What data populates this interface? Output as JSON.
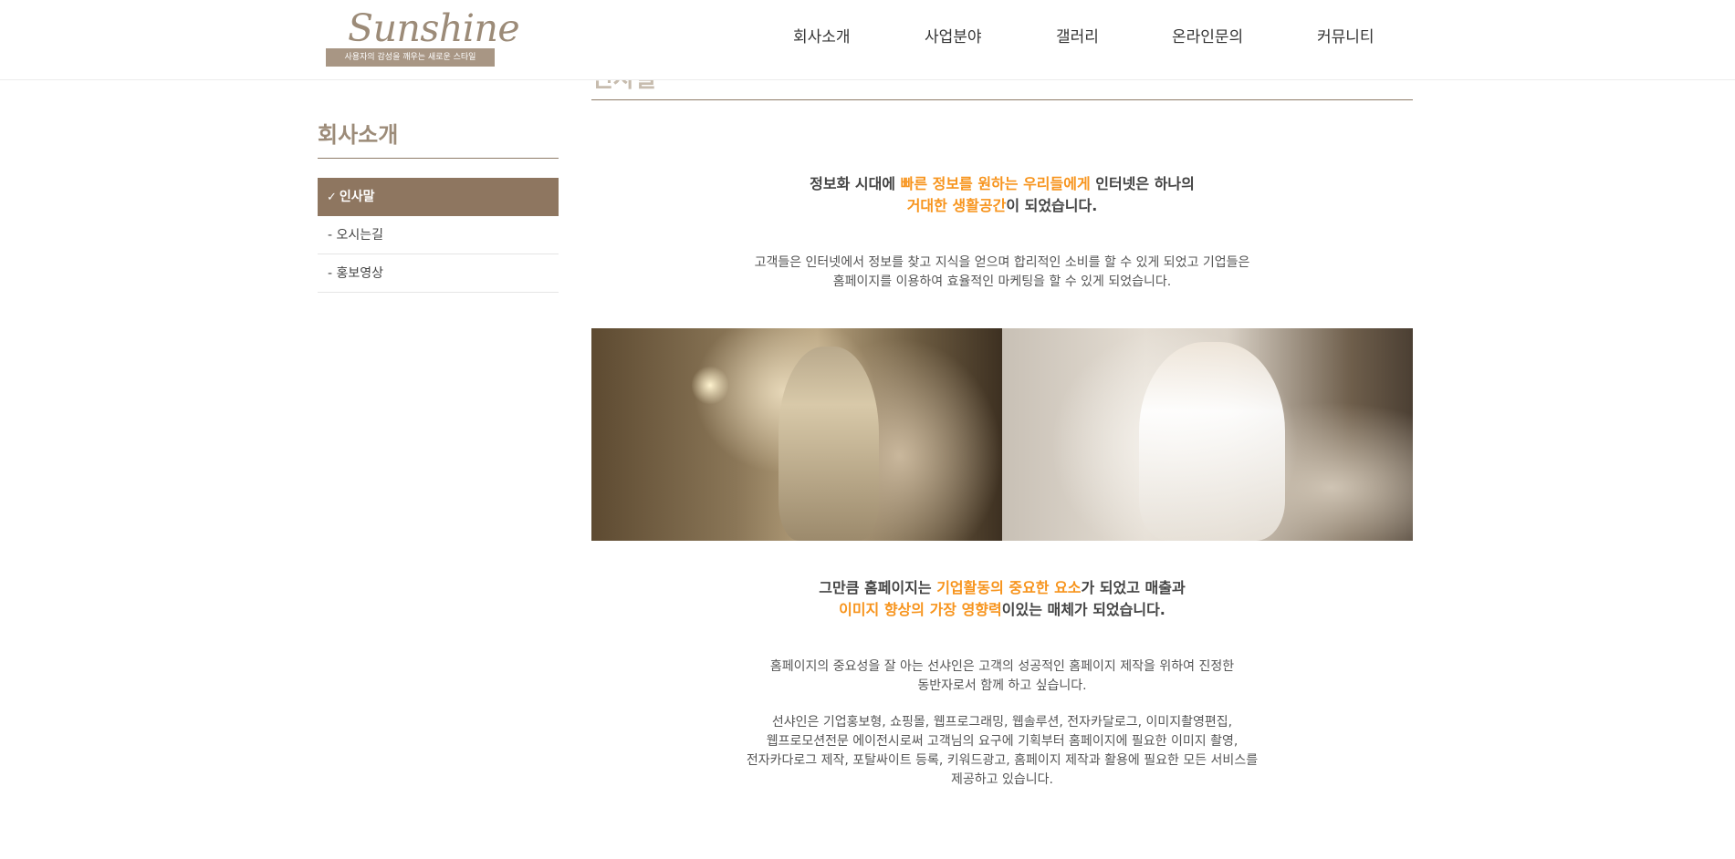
{
  "logo": {
    "word": "Sunshine",
    "tagline": "사용자의 감성을 깨우는 새로운 스타일"
  },
  "nav": [
    {
      "label": "회사소개"
    },
    {
      "label": "사업분야"
    },
    {
      "label": "갤러리"
    },
    {
      "label": "온라인문의"
    },
    {
      "label": "커뮤니티"
    }
  ],
  "sidebar": {
    "title": "회사소개",
    "items": [
      {
        "label": "인사말",
        "active": true
      },
      {
        "label": "- 오시는길"
      },
      {
        "label": "- 홍보영상"
      }
    ]
  },
  "main": {
    "title_peek": "인사말",
    "highlight1": {
      "l1_pre": "정보화 시대에 ",
      "l1_accent": "빠른 정보를 원하는 우리들에게",
      "l1_post": " 인터넷은 하나의",
      "l2_accent": "거대한 생활공간",
      "l2_post": "이 되었습니다."
    },
    "body1": [
      "고객들은 인터넷에서 정보를 찾고 지식을 얻으며 합리적인 소비를 할 수 있게 되었고 기업들은",
      "홈페이지를 이용하여 효율적인 마케팅을 할 수 있게 되었습니다."
    ],
    "highlight2": {
      "l1_pre": "그만큼 홈페이지는 ",
      "l1_accent": "기업활동의 중요한 요소",
      "l1_post": "가 되었고 매출과",
      "l2_accent": "이미지 향상의 가장 영향력",
      "l2_post": "이있는 매체가 되었습니다."
    },
    "body2": [
      "홈페이지의 중요성을 잘 아는 선샤인은 고객의 성공적인 홈페이지 제작을 위하여 진정한",
      "동반자로서 함께 하고 싶습니다."
    ],
    "body3": [
      "선샤인은 기업홍보형, 쇼핑몰, 웹프로그래밍, 웹솔루션, 전자카달로그, 이미지촬영편집,",
      "웹프로모션전문 에이전시로써 고객님의 요구에 기획부터 홈페이지에 필요한 이미지 촬영,",
      "전자카다로그 제작, 포탈싸이트 등록, 키워드광고, 홈페이지 제작과 활용에 필요한 모든 서비스를",
      "제공하고 있습니다."
    ]
  },
  "colors": {
    "accent": "#f7941d",
    "brand": "#8e7660"
  }
}
